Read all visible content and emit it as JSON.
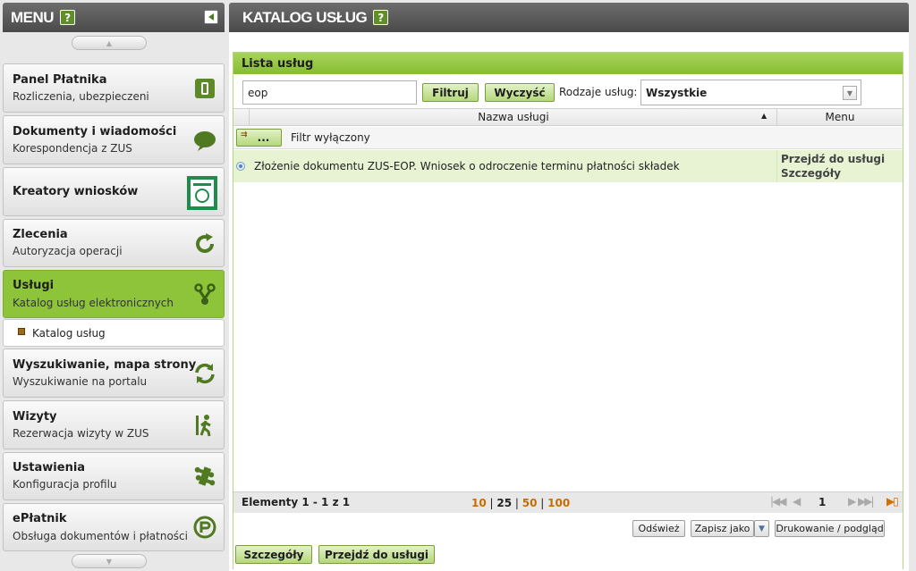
{
  "menu": {
    "title": "MENU",
    "help": "?",
    "items": [
      {
        "title": "Panel Płatnika",
        "subtitle": "Rozliczenia, ubezpieczeni"
      },
      {
        "title": "Dokumenty i wiadomości",
        "subtitle": "Korespondencja z ZUS"
      },
      {
        "title": "Kreatory wniosków",
        "subtitle": ""
      },
      {
        "title": "Zlecenia",
        "subtitle": "Autoryzacja operacji"
      },
      {
        "title": "Usługi",
        "subtitle": "Katalog usług elektronicznych"
      },
      {
        "title": "Wyszukiwanie, mapa strony",
        "subtitle": "Wyszukiwanie na portalu"
      },
      {
        "title": "Wizyty",
        "subtitle": "Rezerwacja wizyty w ZUS"
      },
      {
        "title": "Ustawienia",
        "subtitle": "Konfiguracja profilu"
      },
      {
        "title": "ePłatnik",
        "subtitle": "Obsługa dokumentów i płatności"
      }
    ],
    "subitem": "Katalog usług",
    "icons": [
      "panel-icon",
      "speech-bubble-icon",
      "document-creator-icon",
      "refresh-icon",
      "services-icon",
      "search-sync-icon",
      "walking-person-icon",
      "puzzle-icon",
      "eplatnik-logo-icon"
    ]
  },
  "page": {
    "title": "KATALOG USŁUG",
    "help": "?"
  },
  "panel": {
    "title": "Lista usług",
    "search_value": "eop",
    "filter_button": "Filtruj",
    "clear_button": "Wyczyść",
    "types_label": "Rodzaje usług:",
    "types_selected": "Wszystkie",
    "col_name": "Nazwa usługi",
    "col_menu": "Menu",
    "filter_btn": "...",
    "filter_status": "Filtr wyłączony",
    "rows": [
      {
        "name": "Złożenie dokumentu ZUS-EOP. Wniosek o odroczenie terminu płatności składek",
        "action1": "Przejdź do usługi",
        "action2": "Szczegóły"
      }
    ],
    "elements_label": "Elementy 1 - 1 z 1",
    "page_sizes": [
      "10",
      "25",
      "50",
      "100"
    ],
    "page_number": "1",
    "refresh": "Odśwież",
    "save_as": "Zapisz jako",
    "print": "Drukowanie / podgląd",
    "details_btn": "Szczegóły",
    "goto_btn": "Przejdź do usługi"
  },
  "colors": {
    "accent": "#8dc43a",
    "header": "#555555",
    "page_link": "#c76d00"
  }
}
